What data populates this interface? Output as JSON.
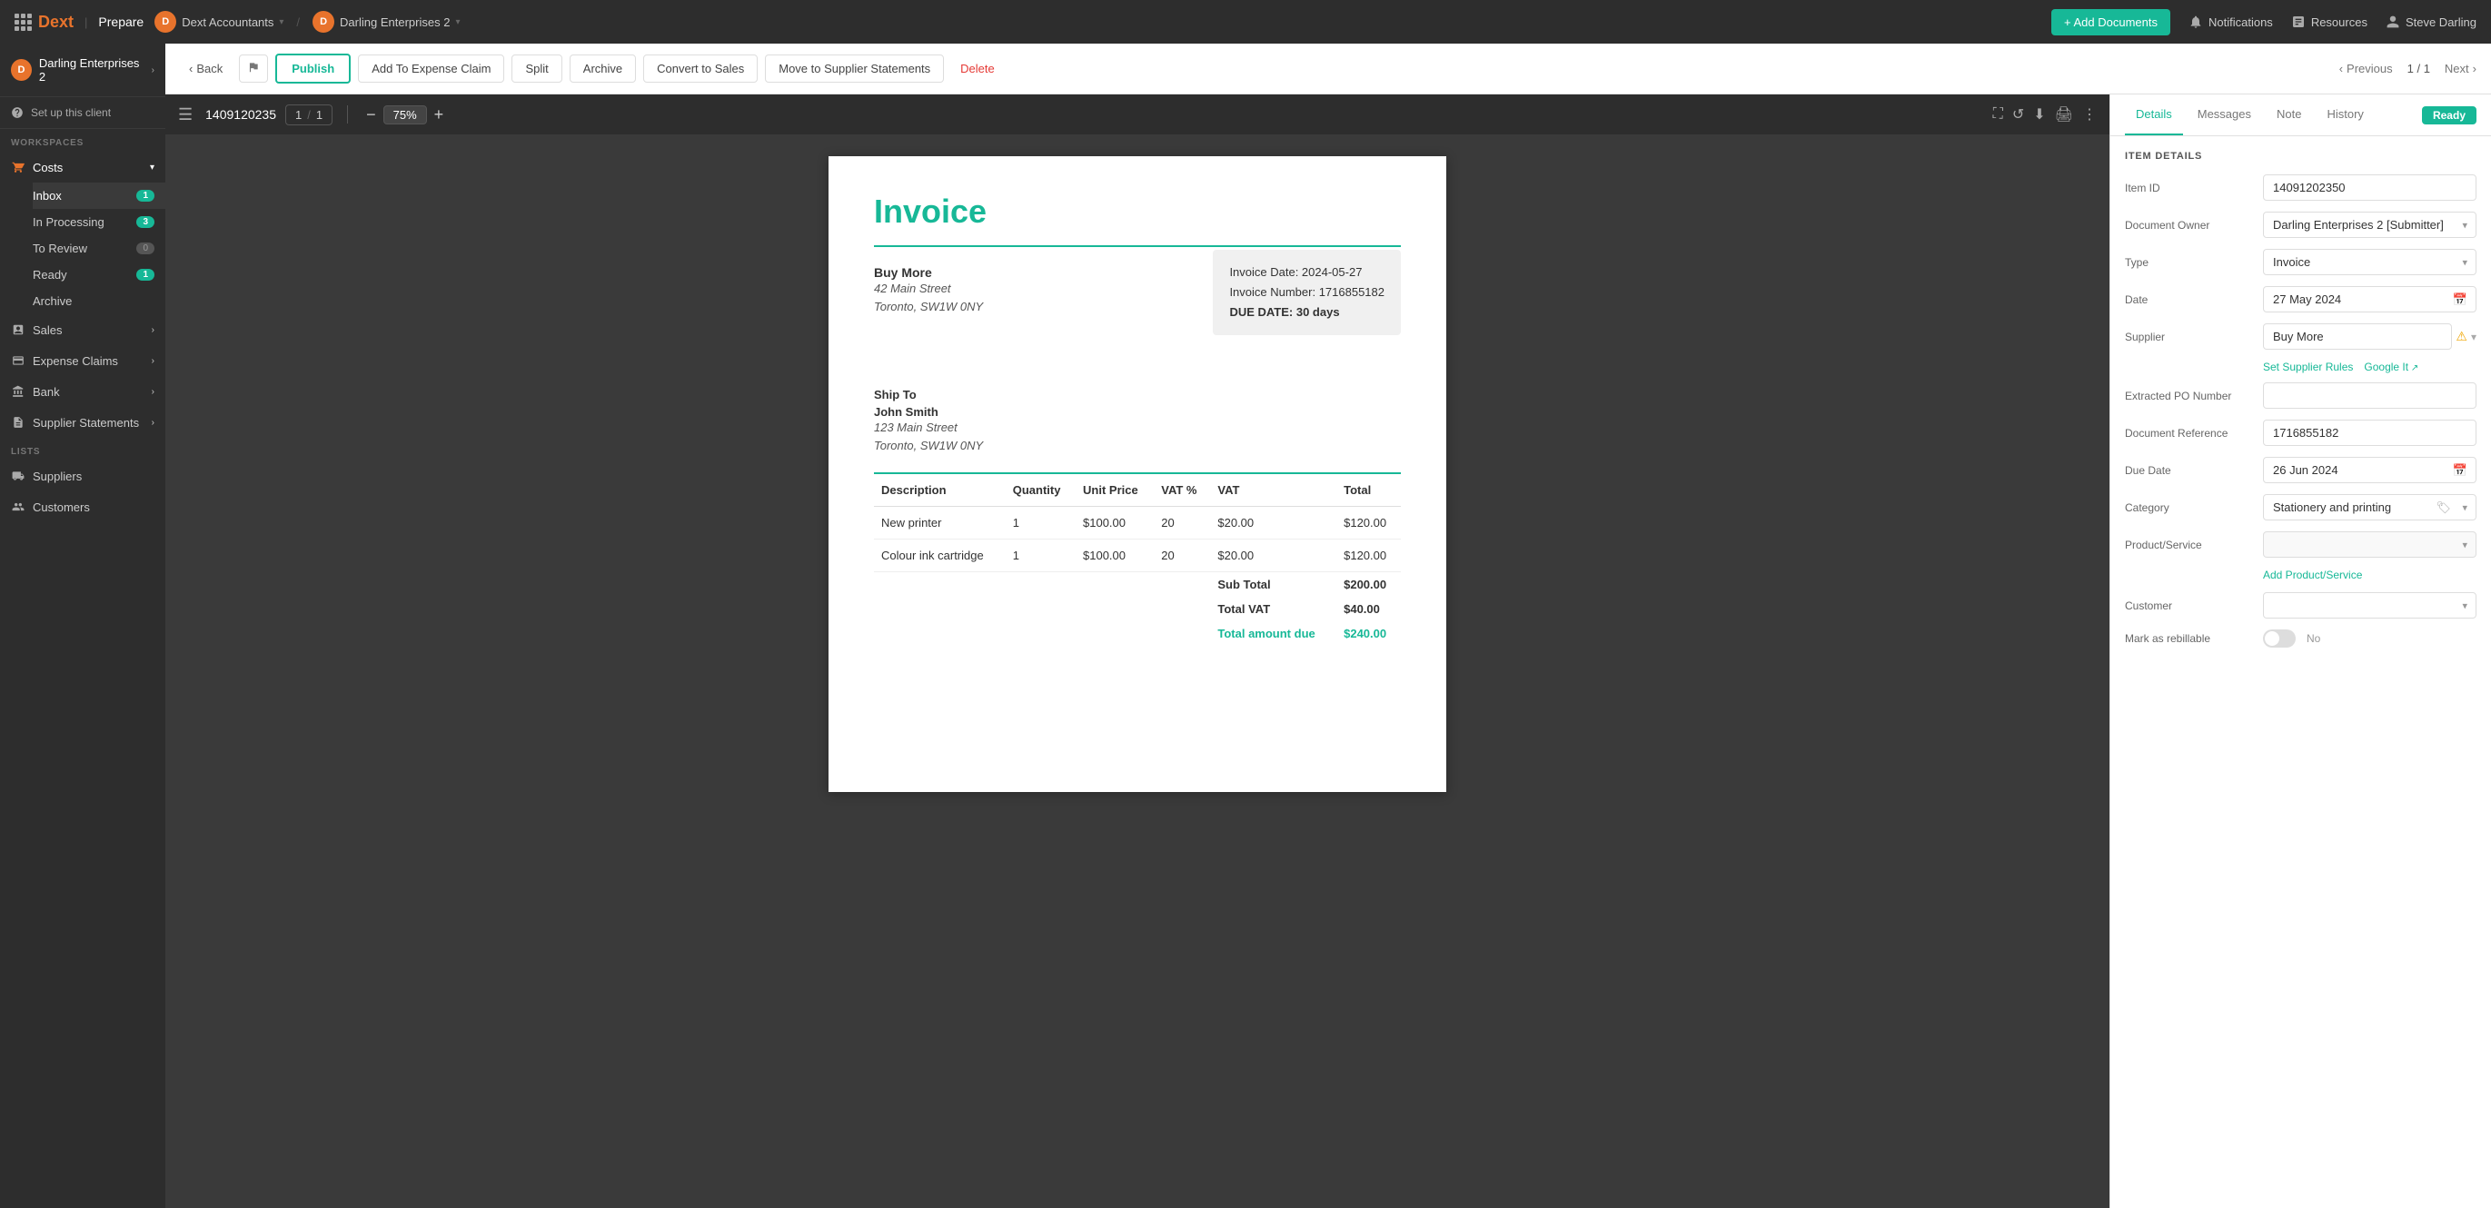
{
  "topNav": {
    "logoText": "Dext",
    "appName": "Prepare",
    "account1": "Dext Accountants",
    "account2": "Darling Enterprises 2",
    "addDocsLabel": "+ Add Documents",
    "notifications": "Notifications",
    "resources": "Resources",
    "user": "Steve Darling"
  },
  "sidebar": {
    "clientName": "Darling Enterprises 2",
    "setupLabel": "Set up this client",
    "workspacesLabel": "WORKSPACES",
    "costsLabel": "Costs",
    "inboxLabel": "Inbox",
    "inboxCount": "1",
    "inProcessingLabel": "In Processing",
    "inProcessingCount": "3",
    "toReviewLabel": "To Review",
    "toReviewCount": "0",
    "readyLabel": "Ready",
    "readyCount": "1",
    "archiveLabel": "Archive",
    "salesLabel": "Sales",
    "expenseClaimsLabel": "Expense Claims",
    "bankLabel": "Bank",
    "supplierStatementsLabel": "Supplier Statements",
    "listsLabel": "LISTS",
    "suppliersLabel": "Suppliers",
    "customersLabel": "Customers"
  },
  "toolbar": {
    "backLabel": "Back",
    "publishLabel": "Publish",
    "addToExpenseLabel": "Add To Expense Claim",
    "splitLabel": "Split",
    "archiveLabel": "Archive",
    "convertLabel": "Convert to Sales",
    "moveToLabel": "Move to Supplier Statements",
    "deleteLabel": "Delete",
    "previousLabel": "Previous",
    "pagination": "1 / 1",
    "nextLabel": "Next"
  },
  "docViewer": {
    "menuIcon": "☰",
    "docNumber": "1409120235",
    "pageNum": "1",
    "pageTotal": "1",
    "zoom": "75%"
  },
  "invoice": {
    "title": "Invoice",
    "fromCompany": "Buy More",
    "fromAddr1": "42 Main Street",
    "fromAddr2": "Toronto, SW1W 0NY",
    "infoDate": "Invoice Date: 2024-05-27",
    "infoNumber": "Invoice Number: 1716855182",
    "infoDue": "DUE DATE: 30 days",
    "shipLabel": "Ship To",
    "shipName": "John Smith",
    "shipAddr1": "123 Main Street",
    "shipAddr2": "Toronto, SW1W 0NY",
    "tableHeaders": [
      "Description",
      "Quantity",
      "Unit Price",
      "VAT %",
      "VAT",
      "Total"
    ],
    "lineItems": [
      {
        "desc": "New printer",
        "qty": "1",
        "unitPrice": "$100.00",
        "vatPct": "20",
        "vat": "$20.00",
        "total": "$120.00"
      },
      {
        "desc": "Colour ink cartridge",
        "qty": "1",
        "unitPrice": "$100.00",
        "vatPct": "20",
        "vat": "$20.00",
        "total": "$120.00"
      }
    ],
    "subTotalLabel": "Sub Total",
    "subTotalValue": "$200.00",
    "totalVatLabel": "Total VAT",
    "totalVatValue": "$40.00",
    "totalDueLabel": "Total amount due",
    "totalDueValue": "$240.00"
  },
  "rightPanel": {
    "tabs": [
      "Details",
      "Messages",
      "Note",
      "History"
    ],
    "activeTab": "Details",
    "statusBadge": "Ready",
    "sectionTitle": "ITEM DETAILS",
    "fields": {
      "itemIdLabel": "Item ID",
      "itemIdValue": "14091202350",
      "docOwnerLabel": "Document Owner",
      "docOwnerValue": "Darling Enterprises 2 [Submitter]",
      "typeLabel": "Type",
      "typeValue": "Invoice",
      "dateLabel": "Date",
      "dateValue": "27 May 2024",
      "supplierLabel": "Supplier",
      "supplierValue": "Buy More",
      "setSupplierRules": "Set Supplier Rules",
      "googleIt": "Google It",
      "extractedPoLabel": "Extracted PO Number",
      "extractedPoValue": "",
      "docRefLabel": "Document Reference",
      "docRefValue": "1716855182",
      "dueDateLabel": "Due Date",
      "dueDateValue": "26 Jun 2024",
      "categoryLabel": "Category",
      "categoryValue": "Stationery and printing",
      "productServiceLabel": "Product/Service",
      "productServiceValue": "",
      "addProductServiceLabel": "Add Product/Service",
      "customerLabel": "Customer",
      "customerValue": "",
      "markRebillableLabel": "Mark as rebillable",
      "markRebillableValue": "No"
    }
  }
}
